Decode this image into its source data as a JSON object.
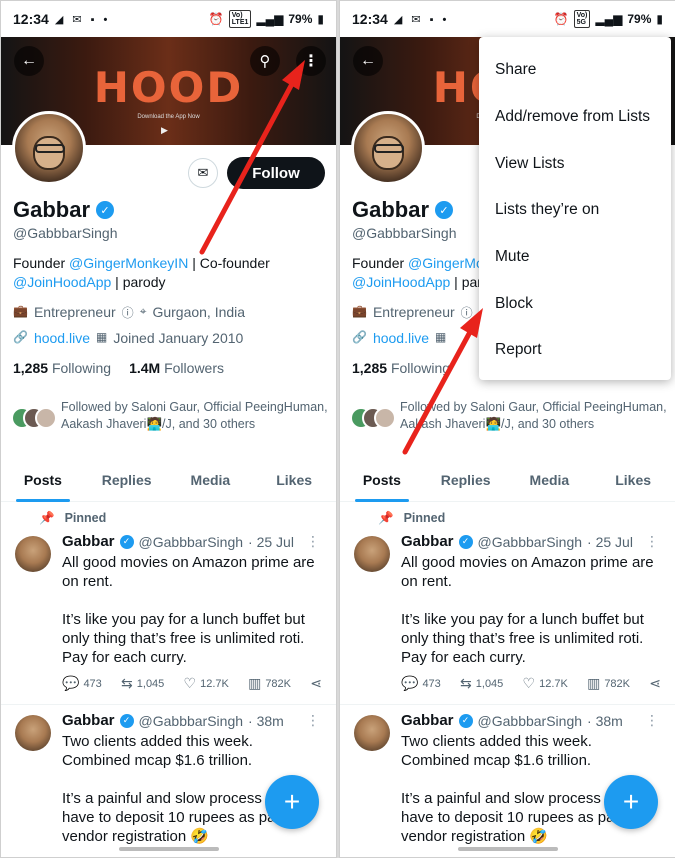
{
  "status": {
    "time": "12:34",
    "battery": "79%",
    "net_top": "Vo)",
    "net_bottom": "LTE1",
    "gen": "5G",
    "notif_icons": "◢ ✉ ▪ •"
  },
  "banner": {
    "logo": "HOOD",
    "tagline": "Download the App Now",
    "stores": "▶ "
  },
  "profile": {
    "name": "Gabbar",
    "handle": "@GabbbarSingh",
    "follow_label": "Follow",
    "bio_prefix": "Founder ",
    "bio_link1": "@GingerMonkeyIN",
    "bio_mid": " | Co-founder ",
    "bio_link2": "@JoinHoodApp",
    "bio_suffix": " | parody",
    "category": "Entrepreneur",
    "location": "Gurgaon, India",
    "website": "hood.live",
    "joined": "Joined January 2010",
    "following_count": "1,285",
    "following_label": "Following",
    "followers_count": "1.4M",
    "followers_label": "Followers",
    "followed_by": "Followed by Saloni Gaur, Official PeeingHuman, Aakash Jhaveri🧑‍💻/J, and 30 others"
  },
  "tabs": [
    "Posts",
    "Replies",
    "Media",
    "Likes"
  ],
  "posts": [
    {
      "pinned_label": "Pinned",
      "name": "Gabbar",
      "handle": "@GabbbarSingh",
      "time": "· 25 Jul",
      "text": "All good movies on Amazon prime are on rent.\n\nIt’s like you pay for a lunch buffet but only thing that’s free is unlimited roti. Pay for each curry.",
      "replies": "473",
      "reposts": "1,045",
      "likes": "12.7K",
      "views": "782K"
    },
    {
      "name": "Gabbar",
      "handle": "@GabbbarSingh",
      "time": "· 38m",
      "text": "Two clients added this week.\nCombined mcap $1.6 trillion.\n\nIt’s a painful and slow process as you have to deposit 10 rupees as part of vendor registration 🤣"
    }
  ],
  "menu": [
    "Share",
    "Add/remove from Lists",
    "View Lists",
    "Lists they’re on",
    "Mute",
    "Block",
    "Report"
  ],
  "colors": {
    "accent": "#1d9bf0",
    "arrow": "#e8231c",
    "text": "#0f1419",
    "secondary": "#536471"
  }
}
